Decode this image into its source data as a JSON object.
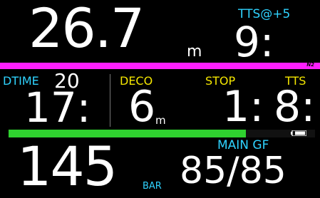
{
  "depth": {
    "value": "26.7",
    "unit": "m"
  },
  "tts_plus5": {
    "label": "TTS@+5",
    "value": "9:"
  },
  "gas_bar": {
    "label": "N2",
    "color": "#ff1fff"
  },
  "dtime": {
    "label": "DTIME",
    "limit": "20",
    "value": "17:"
  },
  "deco": {
    "label": "DECO",
    "value": "6",
    "unit": "m"
  },
  "stop": {
    "label": "STOP",
    "value": "1:"
  },
  "tts": {
    "label": "TTS",
    "value": "8:"
  },
  "tissue_bar": {
    "fill_fraction": 0.775,
    "color": "#2fd12f"
  },
  "battery": {
    "icon": "battery-icon"
  },
  "tank": {
    "value": "145",
    "unit": "BAR"
  },
  "gradient_factor": {
    "label": "MAIN GF",
    "value": "85/85"
  },
  "colors": {
    "label_cyan": "#2fd3ff",
    "label_yellow": "#f4e600",
    "background": "#000000"
  }
}
